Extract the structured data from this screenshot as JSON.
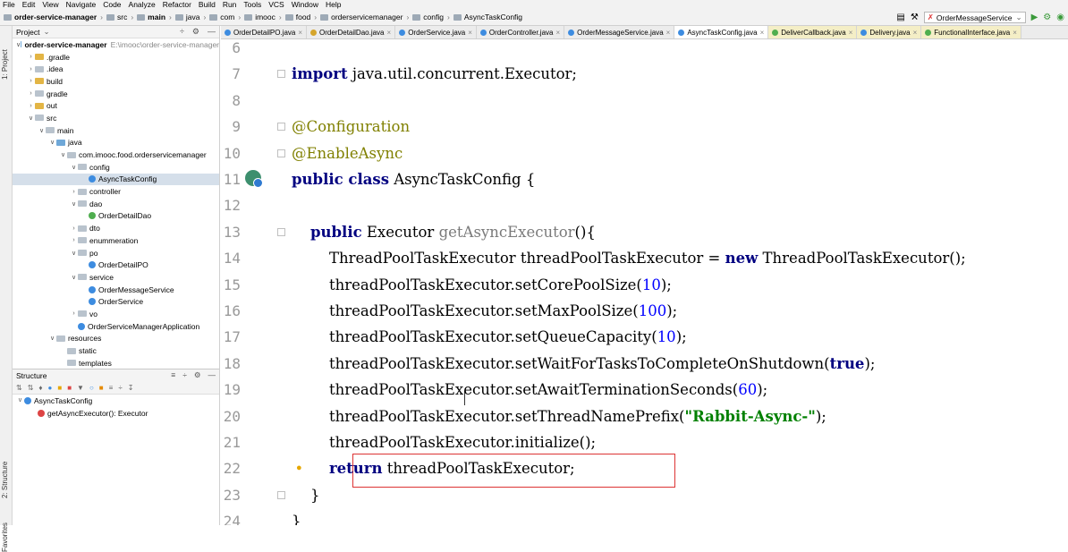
{
  "menu": [
    "File",
    "Edit",
    "View",
    "Navigate",
    "Code",
    "Analyze",
    "Refactor",
    "Build",
    "Run",
    "Tools",
    "VCS",
    "Window",
    "Help"
  ],
  "breadcrumb": [
    "order-service-manager",
    "src",
    "main",
    "java",
    "com",
    "imooc",
    "food",
    "orderservicemanager",
    "config",
    "AsyncTaskConfig"
  ],
  "run_config": "OrderMessageService",
  "left_strip": {
    "project": "1: Project",
    "structure": "2: Structure",
    "favorites": "Favorites"
  },
  "project_panel": {
    "title": "Project",
    "tree": [
      {
        "label": "order-service-manager",
        "extra": "E:\\imooc\\order-service-manager",
        "depth": 0,
        "arrow": "v",
        "icon": "fold blue",
        "bold": true
      },
      {
        "label": ".gradle",
        "depth": 1,
        "arrow": ">",
        "icon": "fold yel"
      },
      {
        "label": ".idea",
        "depth": 1,
        "arrow": ">",
        "icon": "fold gray"
      },
      {
        "label": "build",
        "depth": 1,
        "arrow": ">",
        "icon": "fold yel"
      },
      {
        "label": "gradle",
        "depth": 1,
        "arrow": ">",
        "icon": "fold gray"
      },
      {
        "label": "out",
        "depth": 1,
        "arrow": ">",
        "icon": "fold yel"
      },
      {
        "label": "src",
        "depth": 1,
        "arrow": "v",
        "icon": "fold gray"
      },
      {
        "label": "main",
        "depth": 2,
        "arrow": "v",
        "icon": "fold gray"
      },
      {
        "label": "java",
        "depth": 3,
        "arrow": "v",
        "icon": "fold blue"
      },
      {
        "label": "com.imooc.food.orderservicemanager",
        "depth": 4,
        "arrow": "v",
        "icon": "fold gray"
      },
      {
        "label": "config",
        "depth": 5,
        "arrow": "v",
        "icon": "fold gray"
      },
      {
        "label": "AsyncTaskConfig",
        "depth": 6,
        "arrow": "",
        "icon": "cls",
        "selected": true
      },
      {
        "label": "controller",
        "depth": 5,
        "arrow": ">",
        "icon": "fold gray"
      },
      {
        "label": "dao",
        "depth": 5,
        "arrow": "v",
        "icon": "fold gray"
      },
      {
        "label": "OrderDetailDao",
        "depth": 6,
        "arrow": "",
        "icon": "cls grn"
      },
      {
        "label": "dto",
        "depth": 5,
        "arrow": ">",
        "icon": "fold gray"
      },
      {
        "label": "enummeration",
        "depth": 5,
        "arrow": ">",
        "icon": "fold gray"
      },
      {
        "label": "po",
        "depth": 5,
        "arrow": "v",
        "icon": "fold gray"
      },
      {
        "label": "OrderDetailPO",
        "depth": 6,
        "arrow": "",
        "icon": "cls"
      },
      {
        "label": "service",
        "depth": 5,
        "arrow": "v",
        "icon": "fold gray"
      },
      {
        "label": "OrderMessageService",
        "depth": 6,
        "arrow": "",
        "icon": "cls"
      },
      {
        "label": "OrderService",
        "depth": 6,
        "arrow": "",
        "icon": "cls"
      },
      {
        "label": "vo",
        "depth": 5,
        "arrow": ">",
        "icon": "fold gray"
      },
      {
        "label": "OrderServiceManagerApplication",
        "depth": 5,
        "arrow": "",
        "icon": "cls"
      },
      {
        "label": "resources",
        "depth": 3,
        "arrow": "v",
        "icon": "fold gray"
      },
      {
        "label": "static",
        "depth": 4,
        "arrow": "",
        "icon": "fold gray"
      },
      {
        "label": "templates",
        "depth": 4,
        "arrow": "",
        "icon": "fold gray"
      }
    ]
  },
  "structure_panel": {
    "title": "Structure",
    "items": [
      {
        "label": "AsyncTaskConfig",
        "depth": 0
      },
      {
        "label": "getAsyncExecutor(): Executor",
        "depth": 1
      }
    ]
  },
  "tabs": [
    {
      "label": "OrderDetailPO.java",
      "icon": "c"
    },
    {
      "label": "OrderDetailDao.java",
      "icon": "o"
    },
    {
      "label": "OrderService.java",
      "icon": "c"
    },
    {
      "label": "OrderController.java",
      "icon": "c"
    },
    {
      "label": "OrderMessageService.java",
      "icon": "c"
    },
    {
      "label": "AsyncTaskConfig.java",
      "icon": "c",
      "active": true
    },
    {
      "label": "DeliverCallback.java",
      "icon": "g",
      "yellow": true
    },
    {
      "label": "Delivery.java",
      "icon": "c",
      "yellow": true
    },
    {
      "label": "FunctionalInterface.java",
      "icon": "g",
      "yellow": true
    }
  ],
  "editor": {
    "lines": [
      {
        "n": "6",
        "html": ""
      },
      {
        "n": "7",
        "html": "<span class=\"kw\">import</span> java.util.concurrent.Executor;"
      },
      {
        "n": "8",
        "html": ""
      },
      {
        "n": "9",
        "html": "<span class=\"ann\">@Configuration</span>"
      },
      {
        "n": "10",
        "html": "<span class=\"ann\">@EnableAsync</span>"
      },
      {
        "n": "11",
        "html": "<span class=\"kw\">public class</span> AsyncTaskConfig {"
      },
      {
        "n": "12",
        "html": ""
      },
      {
        "n": "13",
        "html": "    <span class=\"kw\">public</span> Executor <span class=\"mname\">getAsyncExecutor</span>(){"
      },
      {
        "n": "14",
        "html": "        ThreadPoolTaskExecutor threadPoolTaskExecutor = <span class=\"kw\">new</span> ThreadPoolTaskExecutor();"
      },
      {
        "n": "15",
        "html": "        threadPoolTaskExecutor.setCorePoolSize(<span class=\"num\">10</span>);"
      },
      {
        "n": "16",
        "html": "        threadPoolTaskExecutor.setMaxPoolSize(<span class=\"num\">100</span>);"
      },
      {
        "n": "17",
        "html": "        threadPoolTaskExecutor.setQueueCapacity(<span class=\"num\">10</span>);"
      },
      {
        "n": "18",
        "html": "        threadPoolTaskExecutor.setWaitForTasksToCompleteOnShutdown(<span class=\"kw\">true</span>);"
      },
      {
        "n": "19",
        "html": "        threadPoolTaskExecutor.setAwaitTerminationSeconds(<span class=\"num\">60</span>);"
      },
      {
        "n": "20",
        "html": "        threadPoolTaskExecutor.setThreadNamePrefix(<span class=\"str\">\"Rabbit-Async-\"</span>);"
      },
      {
        "n": "21",
        "html": "        threadPoolTaskExecutor.initialize();"
      },
      {
        "n": "22",
        "html": "        <span class=\"kw\">return</span> threadPoolTaskExecutor;"
      },
      {
        "n": "23",
        "html": "    }"
      },
      {
        "n": "24",
        "html": "}"
      }
    ]
  }
}
